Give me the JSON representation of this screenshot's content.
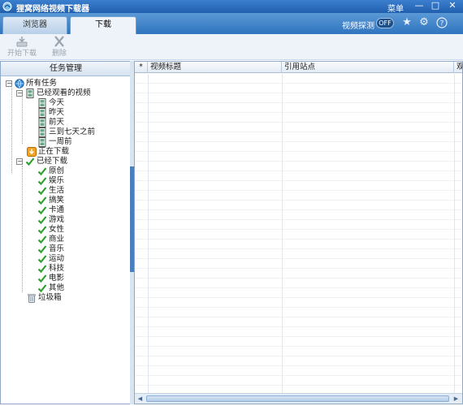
{
  "window": {
    "title": "狸窝网络视频下载器",
    "menu_label": "菜单",
    "minimize_glyph": "—",
    "maximize_glyph": "□",
    "close_glyph": "✕"
  },
  "tabs": [
    {
      "label": "浏览器",
      "active": false
    },
    {
      "label": "下载",
      "active": true
    }
  ],
  "header": {
    "probe_label": "视频探测",
    "probe_toggle": "OFF"
  },
  "toolbar": {
    "start_download_label": "开始下载",
    "delete_label": "删除"
  },
  "task_panel": {
    "title": "任务管理",
    "root": "所有任务",
    "watched": {
      "label": "已经观看的视频",
      "children": [
        "今天",
        "昨天",
        "前天",
        "三到七天之前",
        "一周前"
      ]
    },
    "downloading": "正在下载",
    "downloaded": {
      "label": "已经下载",
      "children": [
        "原创",
        "娱乐",
        "生活",
        "搞笑",
        "卡通",
        "游戏",
        "女性",
        "商业",
        "音乐",
        "运动",
        "科技",
        "电影",
        "其他"
      ]
    },
    "trash": "垃圾箱"
  },
  "grid": {
    "columns": [
      "*",
      "视频标题",
      "引用站点",
      "观"
    ]
  },
  "colors": {
    "accent": "#2f74be",
    "check": "#2fa02f",
    "folder": "#e8a020"
  }
}
